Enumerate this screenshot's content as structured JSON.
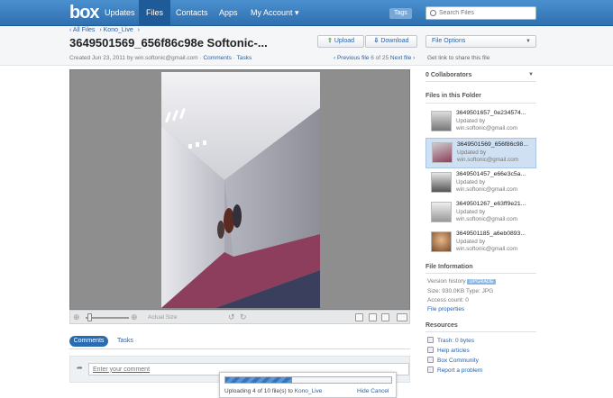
{
  "nav": {
    "logo": "box",
    "items": [
      "Updates",
      "Files",
      "Contacts",
      "Apps",
      "My Account ▾"
    ],
    "active": "Files",
    "tags": "Tags",
    "search_placeholder": "Search Files"
  },
  "header": {
    "breadcrumb": [
      "‹ All Files",
      "› Kono_Live",
      "›"
    ],
    "title": "3649501569_656f86c98e Softonic-...",
    "upload_label": "Upload",
    "download_label": "Download",
    "file_options_label": "File Options",
    "created": "Created Jun 23, 2011 by win.softonic@gmail.com ·",
    "comments_link": "Comments",
    "tasks_link": "Tasks",
    "prev_label": "‹ Previous file",
    "position": "6 of 25",
    "next_label": "Next file ›",
    "share_text": "Get link to share this file"
  },
  "preview_toolbar": {
    "actual_size": "Actual Size",
    "zoom_level": 0.1
  },
  "tabs": {
    "comments": "Comments",
    "tasks": "Tasks"
  },
  "comment": {
    "placeholder": "Enter your comment"
  },
  "upload": {
    "progress": 0.4,
    "text": "Uploading 4 of 10 file(s) to",
    "target": "Kono_Live",
    "hide": "Hide",
    "cancel": "Cancel"
  },
  "sidebar": {
    "collaborators": "0 Collaborators",
    "files_heading": "Files in this Folder",
    "files": [
      {
        "name": "3649501657_0e234574...",
        "updated": "Updated by win.softonic@gmail.com"
      },
      {
        "name": "3649501569_656f86c98...",
        "updated": "Updated by win.softonic@gmail.com"
      },
      {
        "name": "3649501457_e66e3c5a...",
        "updated": "Updated by win.softonic@gmail.com"
      },
      {
        "name": "3649501267_e63ff9e21...",
        "updated": "Updated by win.softonic@gmail.com"
      },
      {
        "name": "3649501185_a6eb0893...",
        "updated": "Updated by win.softonic@gmail.com"
      }
    ],
    "file_info_heading": "File Information",
    "version_history": "Version history",
    "upgrade": "UPGRADE",
    "size": "Size: 930.0KB Type: JPG",
    "access": "Access count: 0",
    "file_properties": "File properties",
    "resources_heading": "Resources",
    "resources": [
      "Trash: 0 bytes",
      "Help articles",
      "Box Community",
      "Report a problem"
    ]
  }
}
